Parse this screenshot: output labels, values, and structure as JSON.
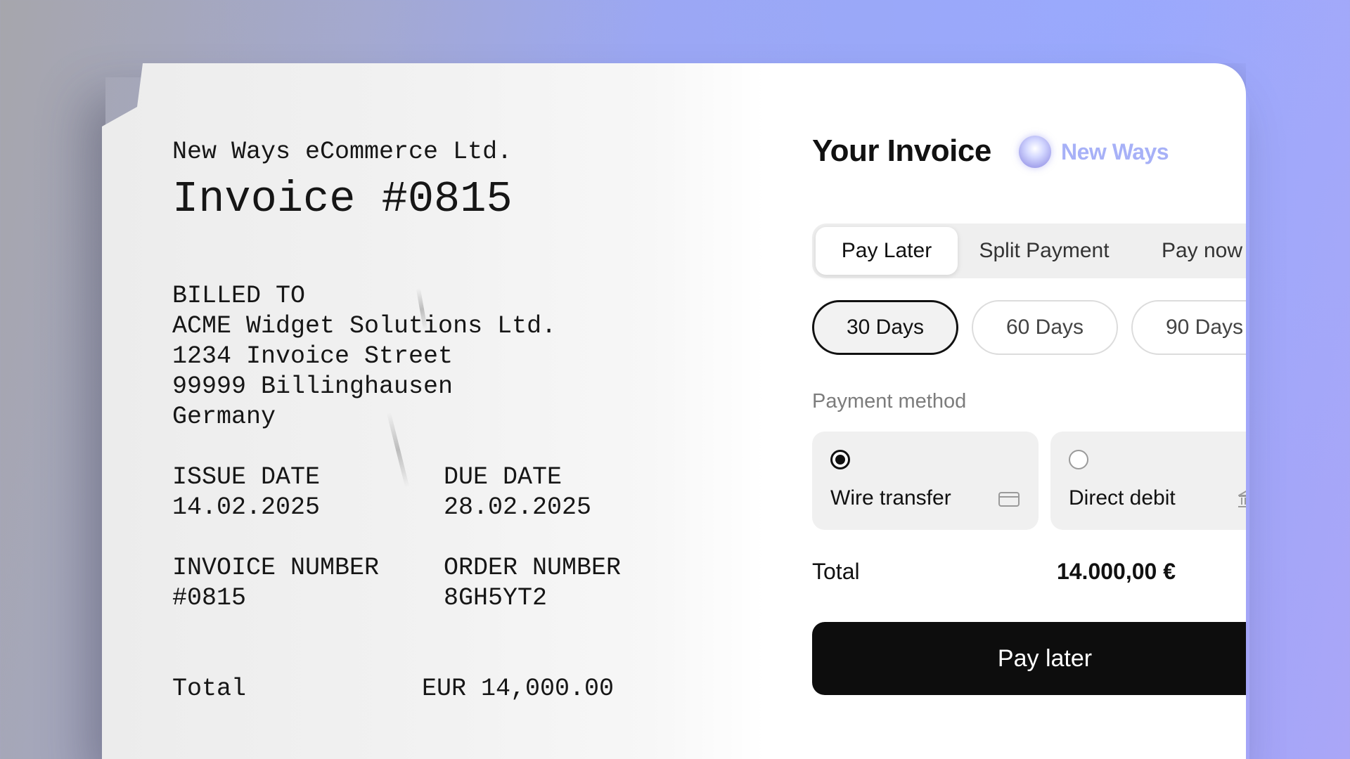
{
  "receipt": {
    "company": "New Ways eCommerce Ltd.",
    "title": "Invoice #0815",
    "billed_to": {
      "label": "BILLED TO",
      "name": "ACME Widget Solutions Ltd.",
      "street": "1234 Invoice Street",
      "city": "99999 Billinghausen",
      "country": "Germany"
    },
    "issue_date": {
      "label": "ISSUE DATE",
      "value": "14.02.2025"
    },
    "due_date": {
      "label": "DUE DATE",
      "value": "28.02.2025"
    },
    "invoice_number": {
      "label": "INVOICE NUMBER",
      "value": "#0815"
    },
    "order_number": {
      "label": "ORDER NUMBER",
      "value": "8GH5YT2"
    },
    "total": {
      "label": "Total",
      "value": "EUR 14,000.00"
    }
  },
  "panel": {
    "title": "Your Invoice",
    "brand": {
      "name": "New Ways",
      "logo_icon": "gradient-orb-icon",
      "color": "#a7b1f7"
    },
    "payment_tabs": [
      {
        "label": "Pay Later",
        "active": true
      },
      {
        "label": "Split Payment",
        "active": false
      },
      {
        "label": "Pay now",
        "active": false
      }
    ],
    "term_options": [
      {
        "label": "30 Days",
        "active": true
      },
      {
        "label": "60 Days",
        "active": false
      },
      {
        "label": "90 Days",
        "active": false
      }
    ],
    "payment_method": {
      "label": "Payment method",
      "options": [
        {
          "label": "Wire transfer",
          "selected": true,
          "icon": "credit-card-icon"
        },
        {
          "label": "Direct debit",
          "selected": false,
          "icon": "bank-icon"
        }
      ]
    },
    "total": {
      "label": "Total",
      "value": "14.000,00 €"
    },
    "cta": {
      "label": "Pay later",
      "color": "#0d0d0d"
    }
  }
}
